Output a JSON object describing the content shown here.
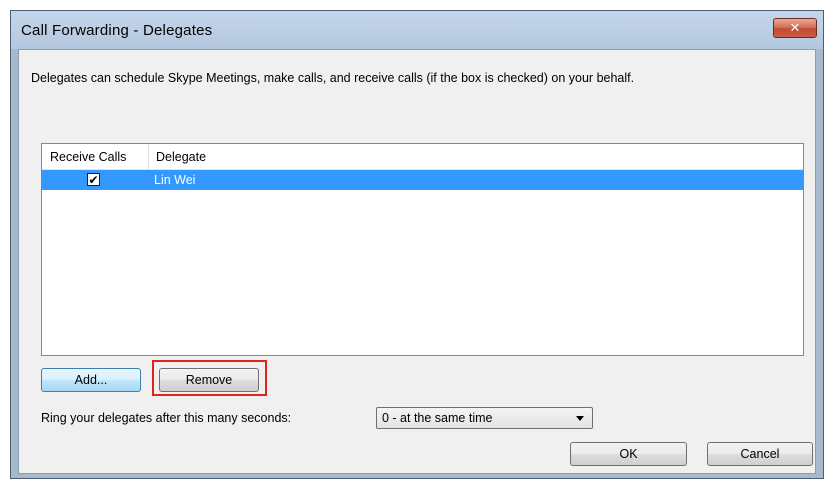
{
  "window": {
    "title": "Call Forwarding - Delegates",
    "close_icon": "close-icon",
    "close_glyph": "✕"
  },
  "description": "Delegates can schedule Skype Meetings, make calls, and receive calls (if the box is checked) on your behalf.",
  "delegates_list": {
    "columns": [
      "Receive Calls",
      "Delegate"
    ],
    "rows": [
      {
        "receive_calls": true,
        "delegate": "Lin Wei",
        "selected": true,
        "check_glyph": "✔"
      }
    ],
    "selection_color": "#3399ff"
  },
  "buttons": {
    "add": "Add...",
    "remove": "Remove",
    "ok": "OK",
    "cancel": "Cancel"
  },
  "ring": {
    "label": "Ring your delegates after this many seconds:",
    "selected_value": "0 - at the same time"
  },
  "highlight_color": "#e2231a"
}
